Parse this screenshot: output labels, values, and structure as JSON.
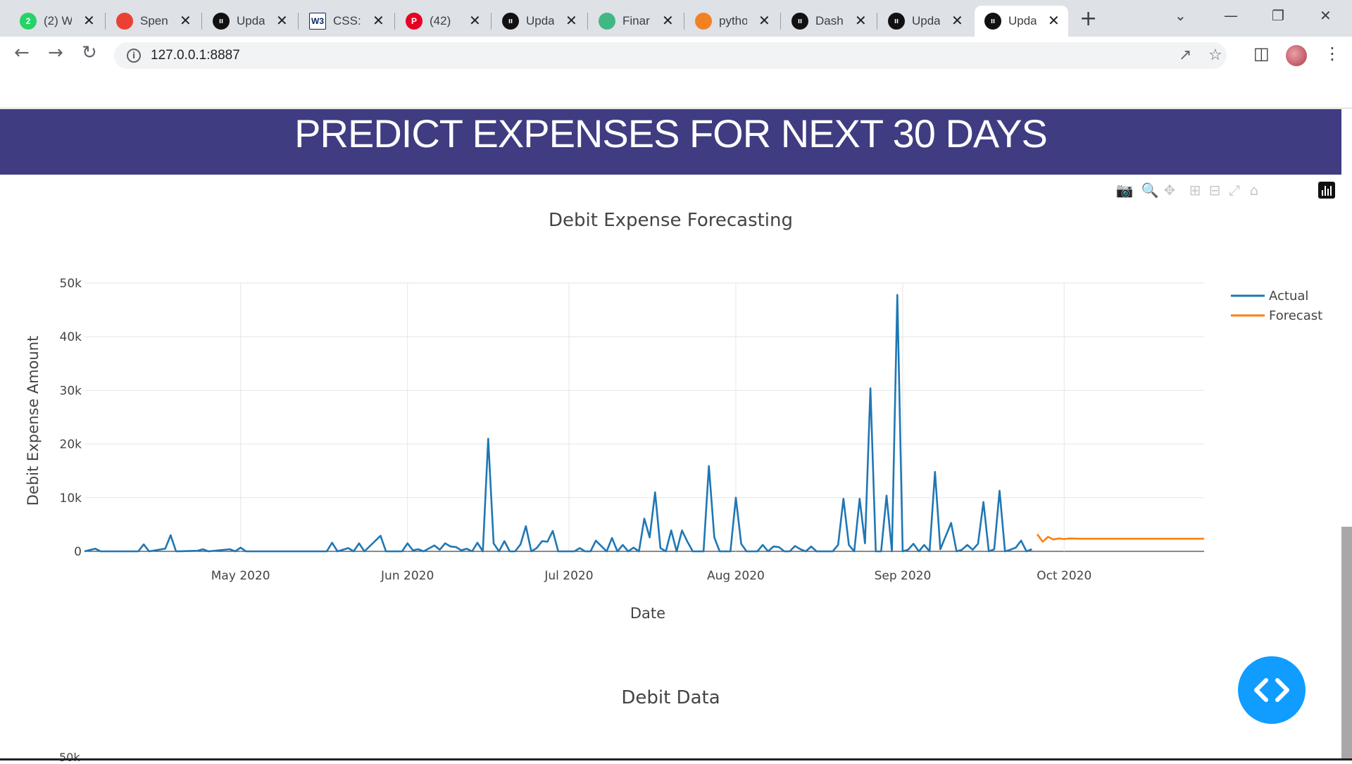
{
  "browser": {
    "tabs": [
      {
        "title": "(2) W",
        "icon": "whatsapp-icon",
        "color": "#25d366",
        "badge": "2"
      },
      {
        "title": "Spen",
        "icon": "pinwheel-icon",
        "color": "#e94235"
      },
      {
        "title": "Upda",
        "icon": "plotly-icon",
        "color": "#111111"
      },
      {
        "title": "CSS:",
        "icon": "w3schools-icon",
        "color": "#ffffff",
        "badge": "W3"
      },
      {
        "title": "(42)",
        "icon": "pinterest-icon",
        "color": "#e60023"
      },
      {
        "title": "Upda",
        "icon": "plotly-icon",
        "color": "#111111"
      },
      {
        "title": "Finar",
        "icon": "vue-icon",
        "color": "#41b883"
      },
      {
        "title": "pytho",
        "icon": "stackoverflow-icon",
        "color": "#f48024"
      },
      {
        "title": "Dash",
        "icon": "plotly-icon",
        "color": "#111111"
      },
      {
        "title": "Upda",
        "icon": "plotly-icon",
        "color": "#111111"
      },
      {
        "title": "Upda",
        "icon": "plotly-icon",
        "color": "#111111",
        "active": true
      }
    ],
    "url": "127.0.0.1:8887"
  },
  "page": {
    "banner_title": "PREDICT EXPENSES FOR NEXT 30 DAYS",
    "second_chart_title": "Debit Data",
    "partial_tick": "50k",
    "colors": {
      "banner": "#3f3c82",
      "actual": "#1f77b4",
      "forecast": "#ff7f0e",
      "fab": "#119dff"
    }
  },
  "chart_data": {
    "type": "line",
    "title": "Debit Expense Forecasting",
    "xlabel": "Date",
    "ylabel": "Debit Expense Amount",
    "xlim": [
      "2020-04-02",
      "2020-10-27"
    ],
    "ylim": [
      0,
      50000
    ],
    "x_ticks": [
      "May 2020",
      "Jun 2020",
      "Jul 2020",
      "Aug 2020",
      "Sep 2020",
      "Oct 2020"
    ],
    "x_tick_dates": [
      "2020-05-01",
      "2020-06-01",
      "2020-07-01",
      "2020-08-01",
      "2020-09-01",
      "2020-10-01"
    ],
    "y_ticks": [
      "0",
      "10k",
      "20k",
      "30k",
      "40k",
      "50k"
    ],
    "y_tick_values": [
      0,
      10000,
      20000,
      30000,
      40000,
      50000
    ],
    "grid": true,
    "legend": "top-right",
    "series": [
      {
        "name": "Actual",
        "color": "#1f77b4",
        "points": [
          [
            "2020-04-02",
            0
          ],
          [
            "2020-04-04",
            500
          ],
          [
            "2020-04-05",
            0
          ],
          [
            "2020-04-12",
            0
          ],
          [
            "2020-04-13",
            1300
          ],
          [
            "2020-04-14",
            0
          ],
          [
            "2020-04-17",
            500
          ],
          [
            "2020-04-18",
            3000
          ],
          [
            "2020-04-19",
            0
          ],
          [
            "2020-04-23",
            100
          ],
          [
            "2020-04-24",
            400
          ],
          [
            "2020-04-25",
            0
          ],
          [
            "2020-04-29",
            400
          ],
          [
            "2020-04-30",
            0
          ],
          [
            "2020-05-01",
            700
          ],
          [
            "2020-05-02",
            0
          ],
          [
            "2020-05-17",
            0
          ],
          [
            "2020-05-18",
            1600
          ],
          [
            "2020-05-19",
            0
          ],
          [
            "2020-05-21",
            600
          ],
          [
            "2020-05-22",
            0
          ],
          [
            "2020-05-23",
            1500
          ],
          [
            "2020-05-24",
            0
          ],
          [
            "2020-05-27",
            2900
          ],
          [
            "2020-05-28",
            0
          ],
          [
            "2020-05-31",
            0
          ],
          [
            "2020-06-01",
            1500
          ],
          [
            "2020-06-02",
            200
          ],
          [
            "2020-06-03",
            400
          ],
          [
            "2020-06-04",
            0
          ],
          [
            "2020-06-06",
            1100
          ],
          [
            "2020-06-07",
            300
          ],
          [
            "2020-06-08",
            1500
          ],
          [
            "2020-06-09",
            900
          ],
          [
            "2020-06-10",
            800
          ],
          [
            "2020-06-11",
            200
          ],
          [
            "2020-06-12",
            500
          ],
          [
            "2020-06-13",
            0
          ],
          [
            "2020-06-14",
            1600
          ],
          [
            "2020-06-15",
            0
          ],
          [
            "2020-06-16",
            21000
          ],
          [
            "2020-06-17",
            1500
          ],
          [
            "2020-06-18",
            0
          ],
          [
            "2020-06-19",
            1900
          ],
          [
            "2020-06-20",
            0
          ],
          [
            "2020-06-21",
            0
          ],
          [
            "2020-06-22",
            1300
          ],
          [
            "2020-06-23",
            4700
          ],
          [
            "2020-06-24",
            0
          ],
          [
            "2020-06-25",
            600
          ],
          [
            "2020-06-26",
            1900
          ],
          [
            "2020-06-27",
            1800
          ],
          [
            "2020-06-28",
            3800
          ],
          [
            "2020-06-29",
            0
          ],
          [
            "2020-07-02",
            0
          ],
          [
            "2020-07-03",
            600
          ],
          [
            "2020-07-04",
            0
          ],
          [
            "2020-07-05",
            0
          ],
          [
            "2020-07-06",
            2000
          ],
          [
            "2020-07-07",
            1000
          ],
          [
            "2020-07-08",
            0
          ],
          [
            "2020-07-09",
            2500
          ],
          [
            "2020-07-10",
            0
          ],
          [
            "2020-07-11",
            1200
          ],
          [
            "2020-07-12",
            0
          ],
          [
            "2020-07-13",
            700
          ],
          [
            "2020-07-14",
            0
          ],
          [
            "2020-07-15",
            6100
          ],
          [
            "2020-07-16",
            2600
          ],
          [
            "2020-07-17",
            11000
          ],
          [
            "2020-07-18",
            600
          ],
          [
            "2020-07-19",
            0
          ],
          [
            "2020-07-20",
            3900
          ],
          [
            "2020-07-21",
            0
          ],
          [
            "2020-07-22",
            3900
          ],
          [
            "2020-07-23",
            1800
          ],
          [
            "2020-07-24",
            0
          ],
          [
            "2020-07-26",
            0
          ],
          [
            "2020-07-27",
            15900
          ],
          [
            "2020-07-28",
            2600
          ],
          [
            "2020-07-29",
            0
          ],
          [
            "2020-07-31",
            0
          ],
          [
            "2020-08-01",
            10000
          ],
          [
            "2020-08-02",
            1400
          ],
          [
            "2020-08-03",
            0
          ],
          [
            "2020-08-05",
            0
          ],
          [
            "2020-08-06",
            1200
          ],
          [
            "2020-08-07",
            0
          ],
          [
            "2020-08-08",
            900
          ],
          [
            "2020-08-09",
            800
          ],
          [
            "2020-08-10",
            0
          ],
          [
            "2020-08-11",
            0
          ],
          [
            "2020-08-12",
            1000
          ],
          [
            "2020-08-13",
            400
          ],
          [
            "2020-08-14",
            0
          ],
          [
            "2020-08-15",
            900
          ],
          [
            "2020-08-16",
            0
          ],
          [
            "2020-08-19",
            0
          ],
          [
            "2020-08-20",
            1200
          ],
          [
            "2020-08-21",
            9800
          ],
          [
            "2020-08-22",
            1200
          ],
          [
            "2020-08-23",
            0
          ],
          [
            "2020-08-24",
            9800
          ],
          [
            "2020-08-25",
            1500
          ],
          [
            "2020-08-26",
            30400
          ],
          [
            "2020-08-27",
            0
          ],
          [
            "2020-08-28",
            0
          ],
          [
            "2020-08-29",
            10400
          ],
          [
            "2020-08-30",
            0
          ],
          [
            "2020-08-31",
            47800
          ],
          [
            "2020-09-01",
            0
          ],
          [
            "2020-09-02",
            300
          ],
          [
            "2020-09-03",
            1400
          ],
          [
            "2020-09-04",
            0
          ],
          [
            "2020-09-05",
            1200
          ],
          [
            "2020-09-06",
            0
          ],
          [
            "2020-09-07",
            14800
          ],
          [
            "2020-09-08",
            400
          ],
          [
            "2020-09-10",
            5300
          ],
          [
            "2020-09-11",
            0
          ],
          [
            "2020-09-12",
            300
          ],
          [
            "2020-09-13",
            1200
          ],
          [
            "2020-09-14",
            300
          ],
          [
            "2020-09-15",
            1400
          ],
          [
            "2020-09-16",
            9200
          ],
          [
            "2020-09-17",
            0
          ],
          [
            "2020-09-18",
            400
          ],
          [
            "2020-09-19",
            11300
          ],
          [
            "2020-09-20",
            0
          ],
          [
            "2020-09-21",
            300
          ],
          [
            "2020-09-22",
            700
          ],
          [
            "2020-09-23",
            2000
          ],
          [
            "2020-09-24",
            0
          ],
          [
            "2020-09-25",
            400
          ]
        ]
      },
      {
        "name": "Forecast",
        "color": "#ff7f0e",
        "points": [
          [
            "2020-09-26",
            3200
          ],
          [
            "2020-09-27",
            1800
          ],
          [
            "2020-09-28",
            2700
          ],
          [
            "2020-09-29",
            2200
          ],
          [
            "2020-09-30",
            2400
          ],
          [
            "2020-10-01",
            2300
          ],
          [
            "2020-10-02",
            2400
          ],
          [
            "2020-10-04",
            2350
          ],
          [
            "2020-10-08",
            2350
          ],
          [
            "2020-10-12",
            2350
          ],
          [
            "2020-10-16",
            2350
          ],
          [
            "2020-10-20",
            2350
          ],
          [
            "2020-10-25",
            2350
          ],
          [
            "2020-10-27",
            2350
          ]
        ]
      }
    ]
  }
}
